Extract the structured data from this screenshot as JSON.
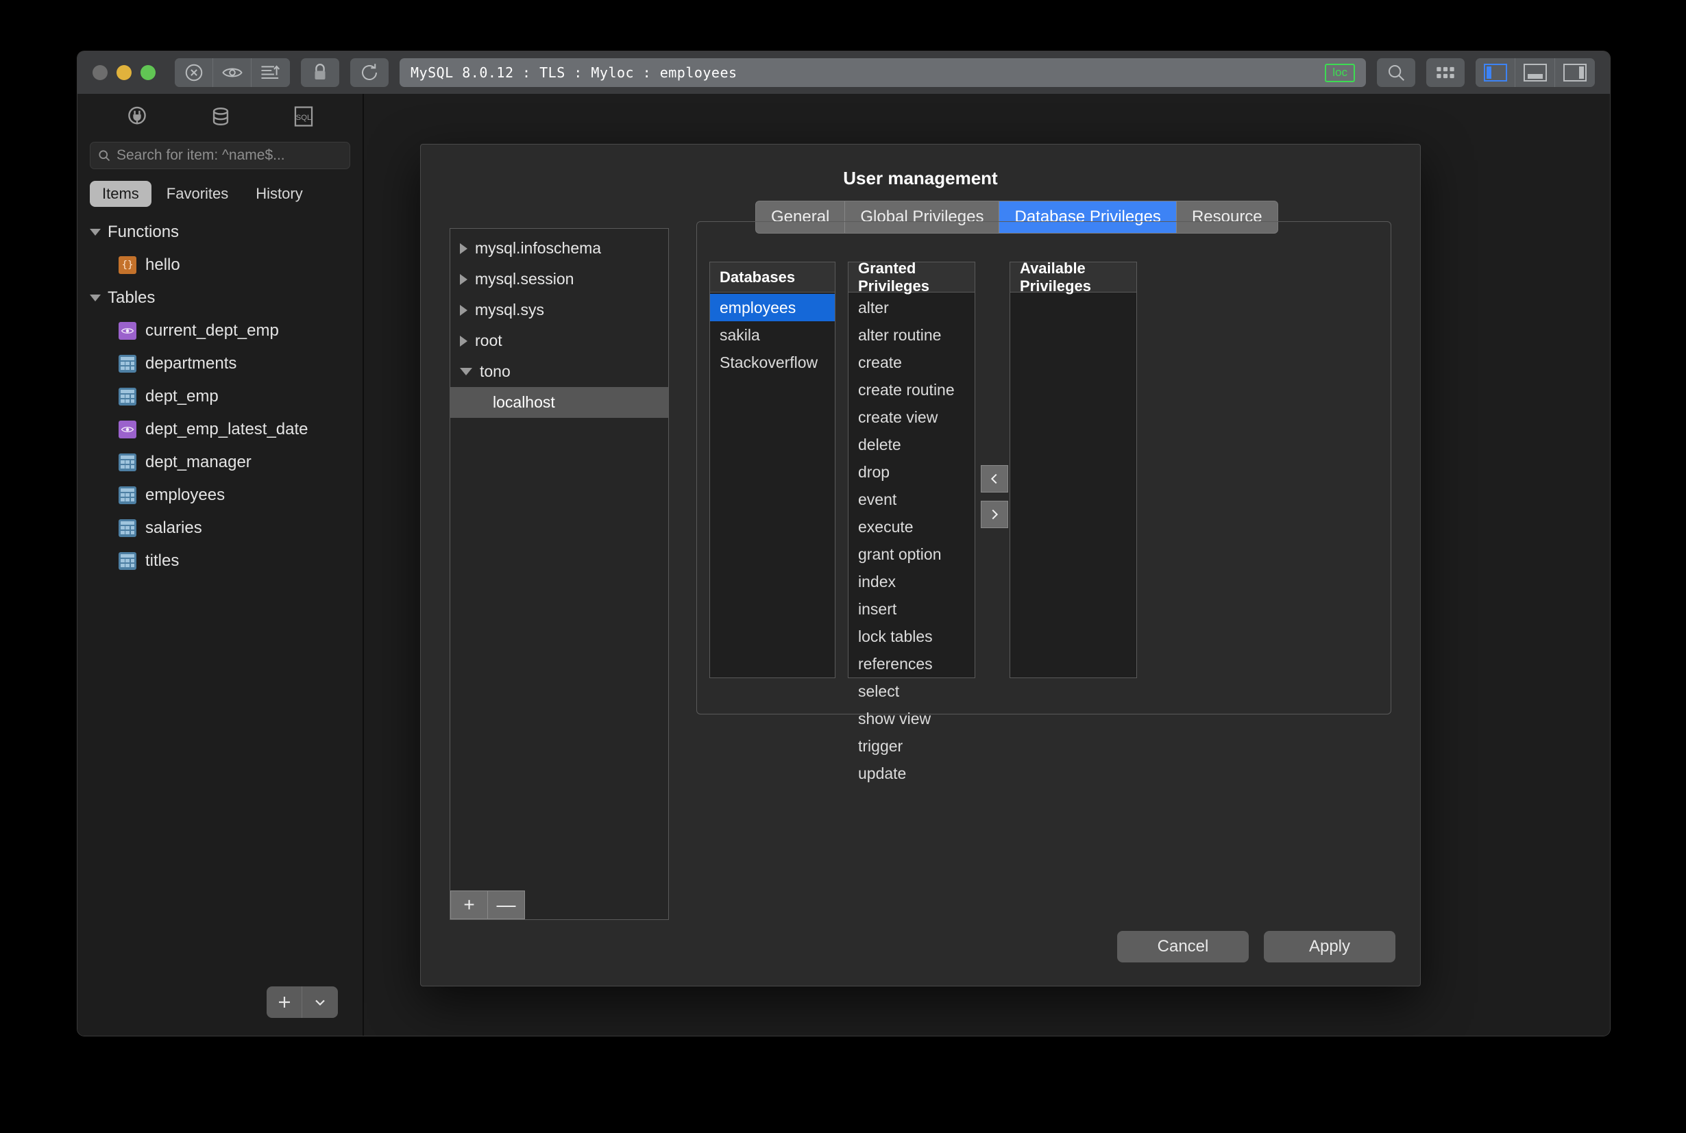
{
  "window": {
    "title": "MySQL 8.0.12 : TLS : Myloc : employees",
    "connection_badge": "loc",
    "traffic_lights": [
      "close-disabled",
      "minimize",
      "zoom"
    ],
    "toolbar_icons": [
      "stop-icon",
      "eye-icon",
      "execute-icon",
      "lock-icon",
      "refresh-icon",
      "search-icon",
      "grid-icon",
      "left-panel-toggle-icon",
      "bottom-panel-toggle-icon",
      "right-panel-toggle-icon"
    ],
    "accent_blue": "#3d83f5",
    "select_blue": "#1568d8",
    "badge_green": "#3ddc52"
  },
  "sidebar": {
    "top_icons": [
      "connection-icon",
      "database-icon",
      "sql-icon"
    ],
    "search": {
      "placeholder": "Search for item: ^name$...",
      "value": ""
    },
    "tabs": [
      {
        "label": "Items",
        "active": true
      },
      {
        "label": "Favorites",
        "active": false
      },
      {
        "label": "History",
        "active": false
      }
    ],
    "groups": [
      {
        "label": "Functions",
        "expanded": true,
        "items": [
          {
            "name": "hello",
            "kind": "function"
          }
        ]
      },
      {
        "label": "Tables",
        "expanded": true,
        "items": [
          {
            "name": "current_dept_emp",
            "kind": "view"
          },
          {
            "name": "departments",
            "kind": "table"
          },
          {
            "name": "dept_emp",
            "kind": "table"
          },
          {
            "name": "dept_emp_latest_date",
            "kind": "view"
          },
          {
            "name": "dept_manager",
            "kind": "table"
          },
          {
            "name": "employees",
            "kind": "table"
          },
          {
            "name": "salaries",
            "kind": "table"
          },
          {
            "name": "titles",
            "kind": "table"
          }
        ]
      }
    ],
    "add_button": {
      "plus": "+",
      "chevron": "chevron-down-icon"
    }
  },
  "dialog": {
    "title": "User management",
    "tabs": [
      {
        "label": "General",
        "active": false
      },
      {
        "label": "Global Privileges",
        "active": false
      },
      {
        "label": "Database Privileges",
        "active": true
      },
      {
        "label": "Resource",
        "active": false
      }
    ],
    "users": [
      {
        "name": "mysql.infoschema",
        "expanded": false,
        "selected": false,
        "child": false
      },
      {
        "name": "mysql.session",
        "expanded": false,
        "selected": false,
        "child": false
      },
      {
        "name": "mysql.sys",
        "expanded": false,
        "selected": false,
        "child": false
      },
      {
        "name": "root",
        "expanded": false,
        "selected": false,
        "child": false
      },
      {
        "name": "tono",
        "expanded": true,
        "selected": false,
        "child": false
      },
      {
        "name": "localhost",
        "expanded": null,
        "selected": true,
        "child": true
      }
    ],
    "user_tree_buttons": {
      "add": "+",
      "remove": "—"
    },
    "panels": {
      "databases": {
        "header": "Databases",
        "rows": [
          {
            "label": "employees",
            "selected": true
          },
          {
            "label": "sakila",
            "selected": false
          },
          {
            "label": "Stackoverflow",
            "selected": false
          }
        ]
      },
      "granted": {
        "header": "Granted Privileges",
        "rows": [
          {
            "label": "alter",
            "selected": false
          },
          {
            "label": "alter routine",
            "selected": false
          },
          {
            "label": "create",
            "selected": false
          },
          {
            "label": "create routine",
            "selected": false
          },
          {
            "label": "create view",
            "selected": false
          },
          {
            "label": "delete",
            "selected": false
          },
          {
            "label": "drop",
            "selected": false
          },
          {
            "label": "event",
            "selected": false
          },
          {
            "label": "execute",
            "selected": false
          },
          {
            "label": "grant option",
            "selected": false
          },
          {
            "label": "index",
            "selected": false
          },
          {
            "label": "insert",
            "selected": false
          },
          {
            "label": "lock tables",
            "selected": false
          },
          {
            "label": "references",
            "selected": false
          },
          {
            "label": "select",
            "selected": false
          },
          {
            "label": "show view",
            "selected": false
          },
          {
            "label": "trigger",
            "selected": false
          },
          {
            "label": "update",
            "selected": false
          }
        ]
      },
      "available": {
        "header": "Available Privileges",
        "rows": []
      }
    },
    "transfer": {
      "left": "chevron-left-icon",
      "right": "chevron-right-icon"
    },
    "footer": {
      "cancel": "Cancel",
      "apply": "Apply"
    }
  }
}
